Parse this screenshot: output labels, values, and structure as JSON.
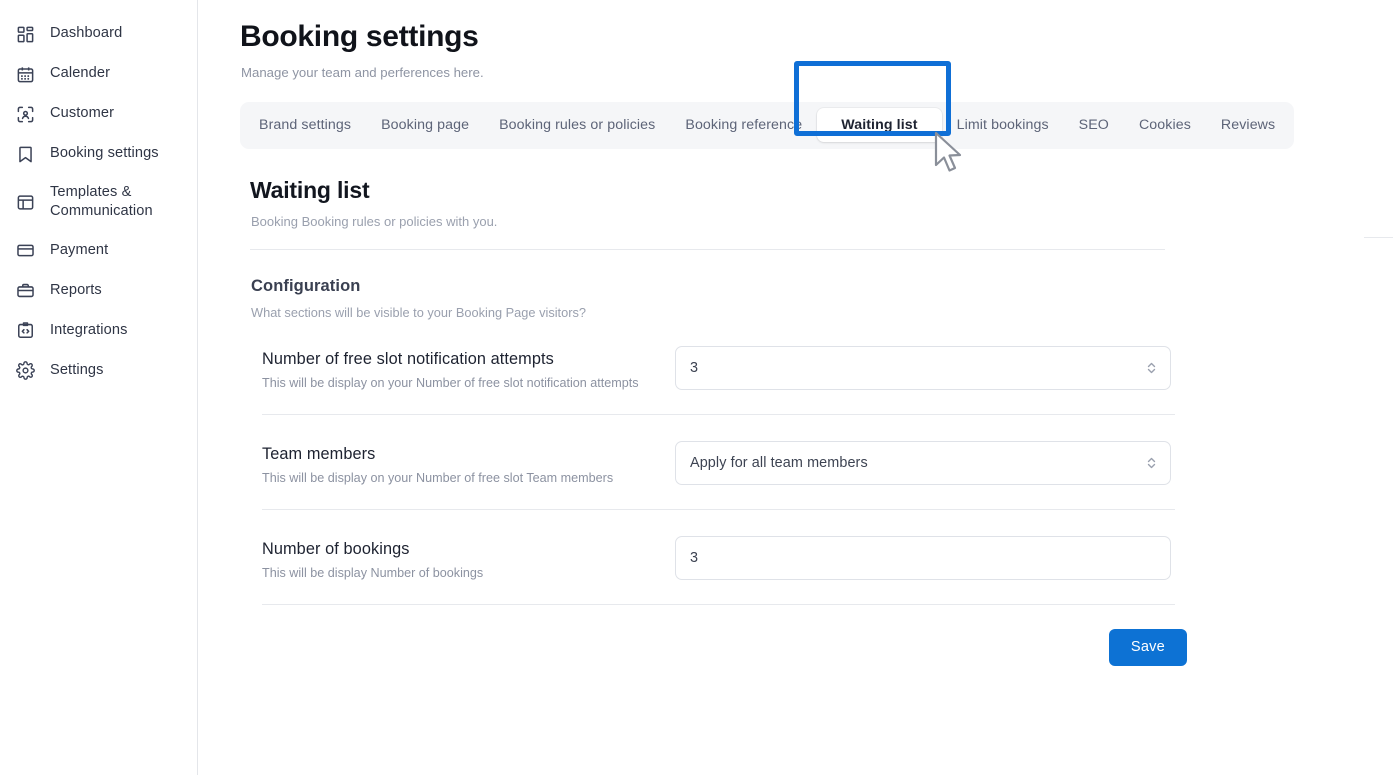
{
  "sidebar": {
    "items": [
      {
        "label": "Dashboard",
        "icon": "grid-dashboard-icon"
      },
      {
        "label": "Calender",
        "icon": "calendar-icon"
      },
      {
        "label": "Customer",
        "icon": "user-scan-icon"
      },
      {
        "label": "Booking settings",
        "icon": "bookmark-icon"
      },
      {
        "label": "Templates & Communication",
        "icon": "layout-template-icon"
      },
      {
        "label": "Payment",
        "icon": "credit-card-icon"
      },
      {
        "label": "Reports",
        "icon": "briefcase-icon"
      },
      {
        "label": "Integrations",
        "icon": "code-clipboard-icon"
      },
      {
        "label": "Settings",
        "icon": "gear-icon"
      }
    ]
  },
  "header": {
    "title": "Booking settings",
    "subtitle": "Manage your team and perferences here."
  },
  "tabs": {
    "items": [
      {
        "label": "Brand settings",
        "active": false
      },
      {
        "label": "Booking page",
        "active": false
      },
      {
        "label": "Booking rules or policies",
        "active": false
      },
      {
        "label": "Booking reference",
        "active": false
      },
      {
        "label": "Waiting list",
        "active": true
      },
      {
        "label": "Limit bookings",
        "active": false
      },
      {
        "label": "SEO",
        "active": false
      },
      {
        "label": "Cookies",
        "active": false
      },
      {
        "label": "Reviews",
        "active": false
      }
    ],
    "highlight_color": "#0f6fd6"
  },
  "section": {
    "title": "Waiting list",
    "subtitle": "Booking Booking rules or policies with you.",
    "config_title": "Configuration",
    "config_subtitle": "What sections will be visible to your Booking Page visitors?"
  },
  "fields": [
    {
      "label": "Number of free slot notification attempts",
      "hint": "This will be display on your Number of free slot notification attempts",
      "value": "3",
      "type": "select"
    },
    {
      "label": "Team members",
      "hint": "This will be display on your Number of free slot Team members",
      "value": "Apply for all team members",
      "type": "select"
    },
    {
      "label": "Number of bookings",
      "hint": "This will be display Number of bookings",
      "value": "3",
      "type": "text"
    }
  ],
  "footer": {
    "save_label": "Save",
    "save_color": "#0d72d4"
  },
  "cursor": {
    "icon": "mouse-pointer-icon"
  }
}
